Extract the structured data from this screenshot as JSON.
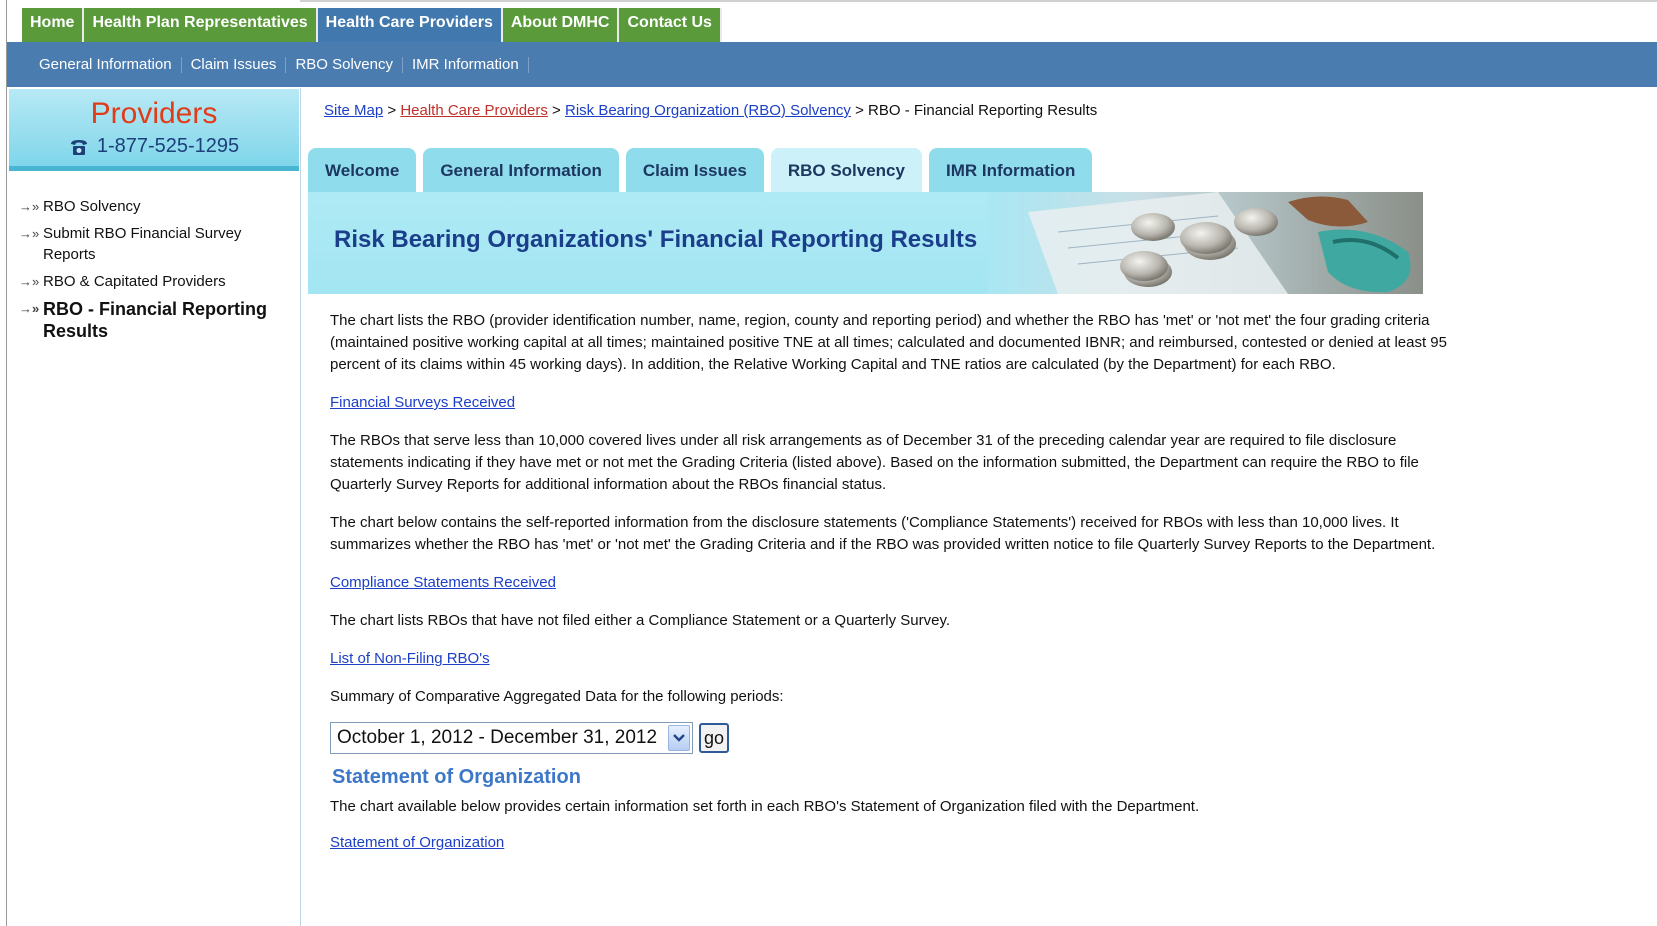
{
  "top_nav": [
    {
      "label": "Home",
      "active": false
    },
    {
      "label": "Health Plan Representatives",
      "active": false
    },
    {
      "label": "Health Care Providers",
      "active": true
    },
    {
      "label": "About DMHC",
      "active": false
    },
    {
      "label": "Contact Us",
      "active": false
    }
  ],
  "sub_nav": [
    "General Information",
    "Claim Issues",
    "RBO Solvency",
    "IMR Information"
  ],
  "sidebar": {
    "title": "Providers",
    "phone": "1-877-525-1295",
    "links": [
      {
        "label": "RBO Solvency"
      },
      {
        "label": "Submit RBO Financial Survey Reports"
      },
      {
        "label": "RBO & Capitated Providers"
      },
      {
        "label": "RBO - Financial Reporting Results"
      }
    ]
  },
  "breadcrumb": {
    "site_map": "Site Map",
    "providers": "Health Care Providers",
    "solvency": "Risk Bearing Organization (RBO) Solvency",
    "current": "RBO - Financial Reporting Results",
    "separator": ">"
  },
  "tabs": [
    {
      "label": "Welcome",
      "active": false
    },
    {
      "label": "General Information",
      "active": false
    },
    {
      "label": "Claim Issues",
      "active": false
    },
    {
      "label": "RBO Solvency",
      "active": true
    },
    {
      "label": "IMR Information",
      "active": false
    }
  ],
  "banner": {
    "title": "Risk Bearing Organizations' Financial Reporting Results"
  },
  "content": {
    "para1": "The chart lists the RBO (provider identification number, name, region, county and reporting period) and whether the RBO has 'met' or 'not met' the four grading criteria (maintained positive working capital at all times; maintained positive TNE at all times; calculated and documented IBNR; and reimbursed, contested or denied at least 95 percent of its claims within 45 working days). In addition, the Relative Working Capital and TNE ratios are calculated (by the Department) for each RBO.",
    "link1": "Financial Surveys Received",
    "para2": "The RBOs that serve less than 10,000 covered lives under all risk arrangements as of December 31 of the preceding calendar year are required to file disclosure statements indicating if they have met or not met the Grading Criteria (listed above). Based on the information submitted, the Department can require the RBO to file Quarterly Survey Reports for additional information about the RBOs financial status.",
    "para3": "The chart below contains the self-reported information from the disclosure statements ('Compliance Statements') received for RBOs with less than 10,000 lives. It summarizes whether the RBO has 'met' or 'not met' the Grading Criteria and if the RBO was provided written notice to file Quarterly Survey Reports to the Department.",
    "link2": "Compliance Statements Received",
    "para4": "The chart lists RBOs that have not filed either a Compliance Statement or a Quarterly Survey.",
    "link3": "List of Non-Filing RBO's",
    "para5": "Summary of Comparative Aggregated Data for the following periods:",
    "period_selected": "October 1, 2012 - December 31, 2012",
    "go_label": "go",
    "section_heading": "Statement of Organization",
    "para6": "The chart available below provides certain information set forth in each RBO's Statement of Organization filed with the Department.",
    "link4": "Statement of Organization"
  },
  "icons": {
    "phone": "phone-icon",
    "arrow": "double-arrow-icon",
    "dropdown": "chevron-down-icon"
  },
  "colors": {
    "top_nav_green": "#5a9a3a",
    "nav_blue": "#4a7cb0",
    "provider_red": "#e23b18",
    "banner_cyan": "#aeeaf5",
    "tab_cyan": "#8fdcec",
    "link_blue": "#1c3fc7",
    "heading_blue": "#3d78c8"
  }
}
